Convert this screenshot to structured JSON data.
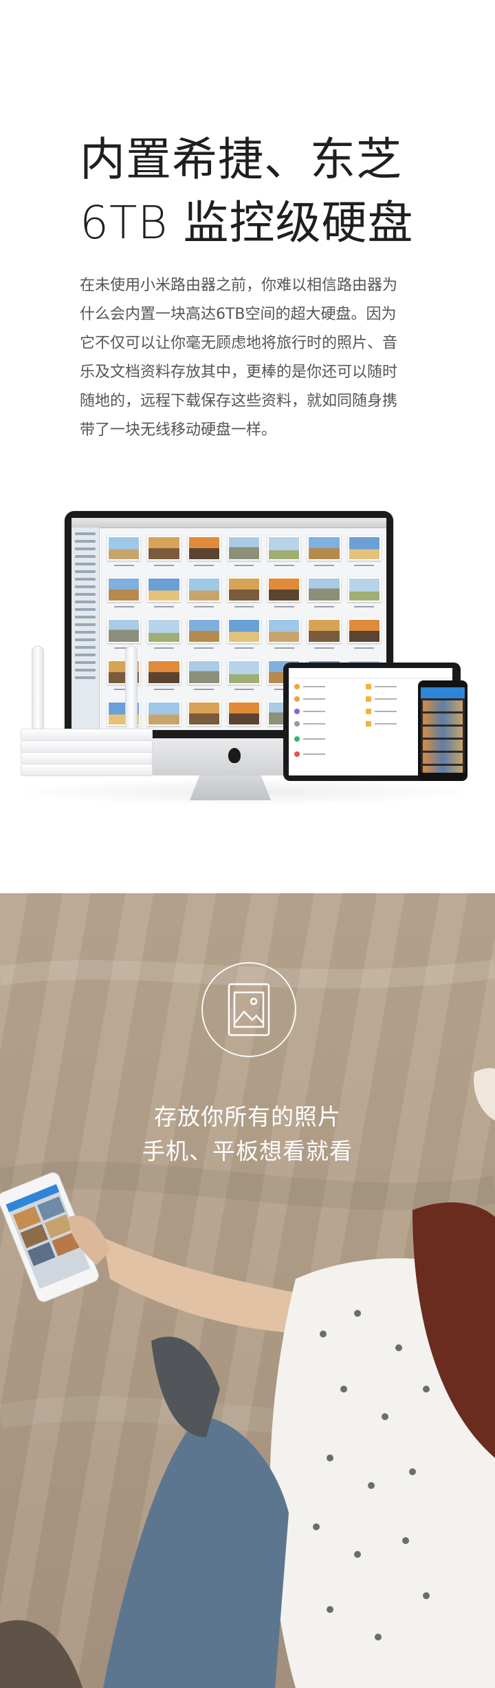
{
  "hero": {
    "title_line1": "内置希捷、东芝",
    "title_line2": "6TB 监控级硬盘"
  },
  "intro": {
    "lines": [
      "在未使用小米路由器之前，你难以相信路由器为",
      "什么会内置一块高达6TB空间的超大硬盘。因为",
      "它不仅可以让你毫无顾虑地将旅行时的照片、音",
      "乐及文档资料存放其中，更棒的是你还可以随时",
      "随地的，远程下载保存这些资料，就如同随身携",
      "带了一块无线移动硬盘一样。"
    ]
  },
  "photo_section": {
    "icon": "photo-frame-icon",
    "slogan_line1": "存放你所有的照片",
    "slogan_line2": "手机、平板想看就看"
  },
  "colors": {
    "background": "#ffffff",
    "photo_bg": "#b3a08a",
    "phone_accent": "#2f86d6"
  }
}
